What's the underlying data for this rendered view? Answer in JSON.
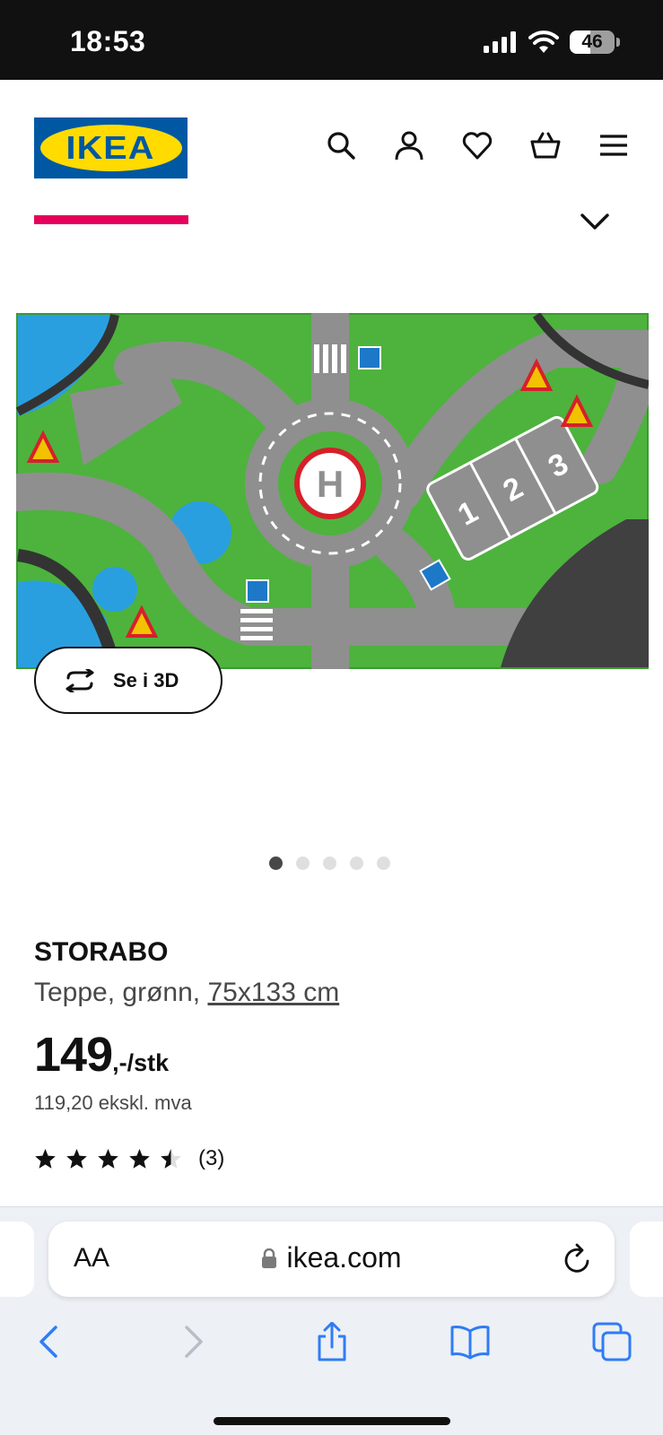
{
  "status_bar": {
    "time": "18:53",
    "battery": "46",
    "battery_level": 0.46
  },
  "header": {
    "logo_text": "IKEA",
    "icons": [
      "search-icon",
      "account-icon",
      "heart-icon",
      "basket-icon",
      "menu-icon"
    ]
  },
  "gallery": {
    "view_3d_label": "Se i 3D",
    "image_count": 5,
    "active_index": 0
  },
  "product": {
    "name": "STORABO",
    "description": "Teppe, grønn, ",
    "size": "75x133 cm",
    "price_int": "149",
    "price_suffix": ",-/stk",
    "price_ex_vat": "119,20 ekskl. mva",
    "rating": 4.5,
    "rating_count": "(3)"
  },
  "browser": {
    "aa_label": "AA",
    "url": "ikea.com"
  },
  "colors": {
    "ikea_blue": "#0058a3",
    "ikea_yellow": "#ffdb00",
    "accent_pink": "#e5005c",
    "safari_blue": "#2f7cf6"
  }
}
